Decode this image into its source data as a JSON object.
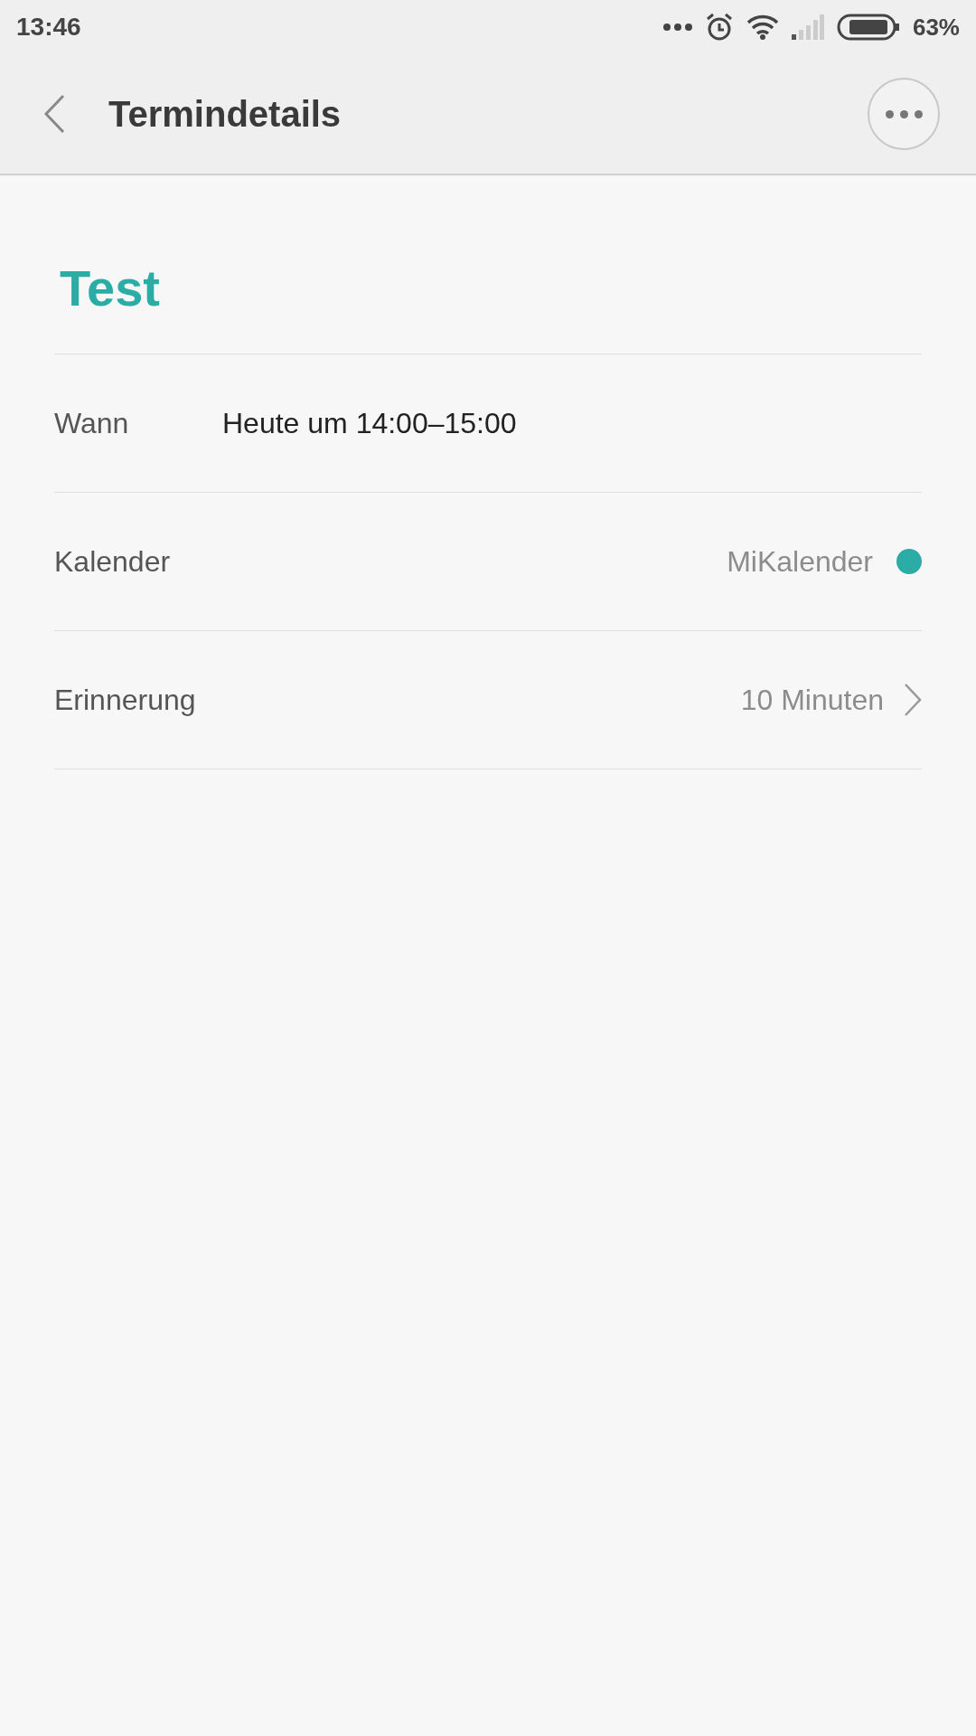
{
  "status_bar": {
    "time": "13:46",
    "battery": "63%"
  },
  "header": {
    "title": "Termindetails"
  },
  "event": {
    "title": "Test"
  },
  "details": [
    {
      "kind": "text",
      "label": "Wann",
      "value": "Heute um 14:00–15:00"
    },
    {
      "kind": "calendar",
      "label": "Kalender",
      "value": "MiKalender",
      "color": "#2bada6"
    },
    {
      "kind": "link",
      "label": "Erinnerung",
      "value": "10 Minuten"
    }
  ]
}
